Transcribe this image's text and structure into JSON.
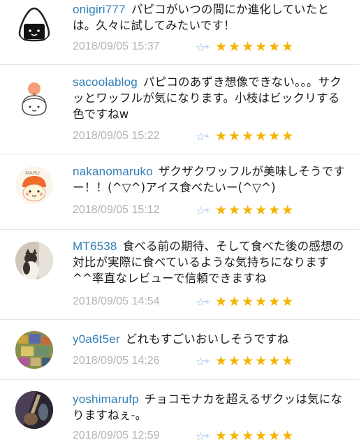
{
  "comments": [
    {
      "username": "onigiri777",
      "text": "パピコがいつの間にか進化していたとは。久々に試してみたいです！",
      "timestamp": "2018/09/05 15:37",
      "stars": "★★★★★★",
      "avatar": "onigiri"
    },
    {
      "username": "sacoolablog",
      "text": "パピコのあずき想像できない。。。サクッとワッフルが気になります。小枝はビックリする色ですねw",
      "timestamp": "2018/09/05 15:22",
      "stars": "★★★★★★",
      "avatar": "girl"
    },
    {
      "username": "nakanomaruko",
      "text": "ザクザクワッフルが美味しそうですー！！(^▽^)アイス食べたいー(^▽^)",
      "timestamp": "2018/09/05 15:12",
      "stars": "★★★★★★",
      "avatar": "maru"
    },
    {
      "username": "MT6538",
      "text": "食べる前の期待、そして食べた後の感想の対比が実際に食べているような気持ちになります^^率直なレビューで信頼できますね",
      "timestamp": "2018/09/05 14:54",
      "stars": "★★★★★★",
      "avatar": "cat"
    },
    {
      "username": "y0a6t5er",
      "text": "どれもすごいおいしそうですね",
      "timestamp": "2018/09/05 14:26",
      "stars": "★★★★★★",
      "avatar": "mosaic"
    },
    {
      "username": "yoshimarufp",
      "text": "チョコモナカを超えるザクッは気になりますねぇ-。",
      "timestamp": "2018/09/05 12:59",
      "stars": "★★★★★★",
      "avatar": "dark"
    }
  ]
}
